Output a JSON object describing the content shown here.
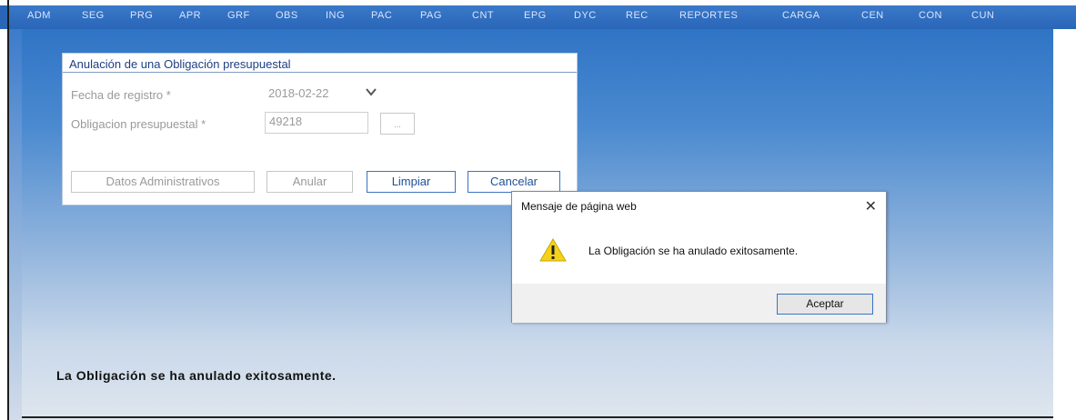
{
  "menu": {
    "items": [
      "ADM",
      "SEG",
      "PRG",
      "APR",
      "GRF",
      "OBS",
      "ING",
      "PAC",
      "PAG",
      "CNT",
      "EPG",
      "DYC",
      "REC",
      "REPORTES",
      "CARGA",
      "CEN",
      "CON",
      "CUN"
    ]
  },
  "panel": {
    "title": "Anulación de una Obligación presupuestal",
    "fecha_label": "Fecha de registro *",
    "fecha_value": "2018-02-22",
    "obligacion_label": "Obligacion presupuestal *",
    "obligacion_value": "49218",
    "browse_button": "...",
    "buttons": {
      "datos": "Datos Administrativos",
      "anular": "Anular",
      "limpiar": "Limpiar",
      "cancelar": "Cancelar"
    }
  },
  "dialog": {
    "title": "Mensaje de página web",
    "close": "✕",
    "message": "La Obligación se ha anulado exitosamente.",
    "ok_button": "Aceptar",
    "icon": "warning-icon"
  },
  "status": {
    "message": "La Obligación se ha anulado exitosamente."
  },
  "colors": {
    "menu_bg": "#2a66b8",
    "accent": "#3a74c0"
  }
}
